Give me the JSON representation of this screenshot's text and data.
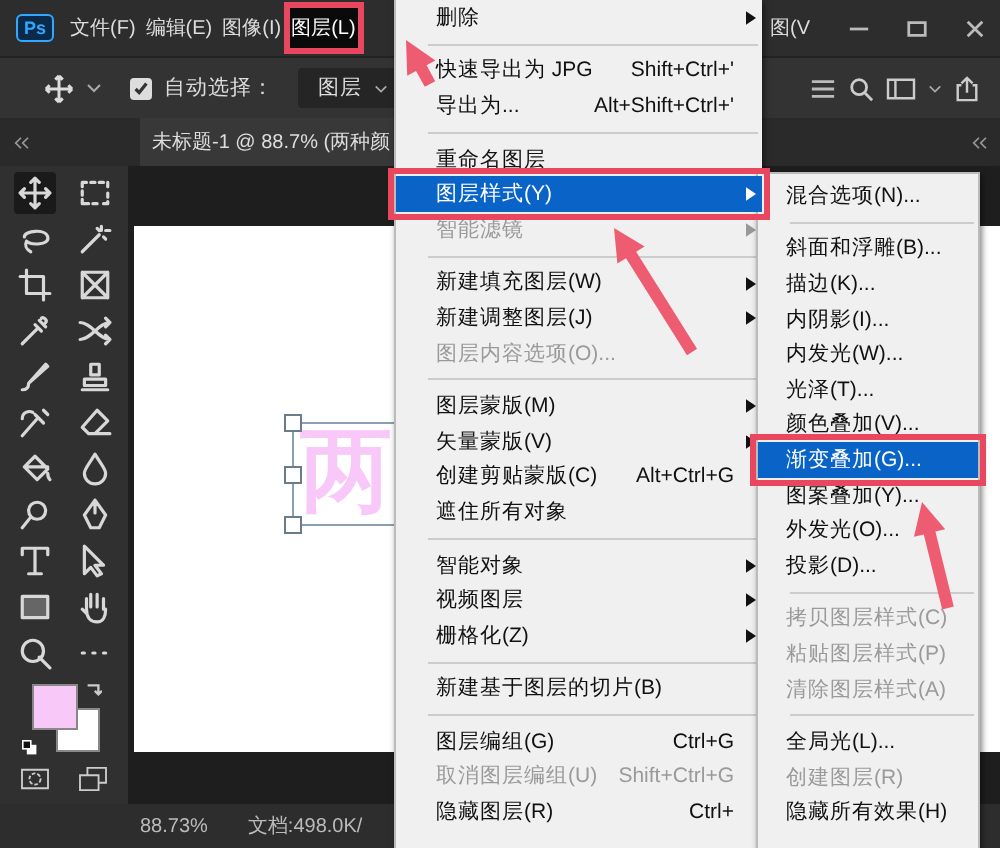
{
  "logo": "Ps",
  "menubar": {
    "items": [
      {
        "label": "文件(F)",
        "selected": false
      },
      {
        "label": "编辑(E)",
        "selected": false
      },
      {
        "label": "图像(I)",
        "selected": false
      },
      {
        "label": "图层(L)",
        "selected": true
      }
    ],
    "partial_label": "图(V"
  },
  "options_bar": {
    "auto_select": {
      "label": "自动选择：",
      "checked": true
    },
    "target_dropdown": "图层"
  },
  "document_tab": "未标题-1 @ 88.7% (两种颜",
  "canvas": {
    "text": "两"
  },
  "status_bar": {
    "zoom": "88.73%",
    "doc_info": "文档:498.0K/"
  },
  "layer_menu": {
    "items": [
      {
        "kind": "item",
        "label": "删除",
        "submenu": true,
        "disabled": false,
        "selected": false
      },
      {
        "kind": "separator"
      },
      {
        "kind": "item",
        "label": "快速导出为 JPG",
        "shortcut": "Shift+Ctrl+'",
        "submenu": false,
        "disabled": false,
        "selected": false
      },
      {
        "kind": "item",
        "label": "导出为...",
        "shortcut": "Alt+Shift+Ctrl+'",
        "submenu": false,
        "disabled": false,
        "selected": false
      },
      {
        "kind": "separator"
      },
      {
        "kind": "item",
        "label": "重命名图层",
        "submenu": false,
        "disabled": false,
        "selected": false
      },
      {
        "kind": "item",
        "label": "图层样式(Y)",
        "submenu": true,
        "disabled": false,
        "selected": true
      },
      {
        "kind": "item",
        "label": "智能滤镜",
        "submenu": true,
        "disabled": true,
        "selected": false
      },
      {
        "kind": "separator"
      },
      {
        "kind": "item",
        "label": "新建填充图层(W)",
        "submenu": true,
        "disabled": false,
        "selected": false
      },
      {
        "kind": "item",
        "label": "新建调整图层(J)",
        "submenu": true,
        "disabled": false,
        "selected": false
      },
      {
        "kind": "item",
        "label": "图层内容选项(O)...",
        "submenu": false,
        "disabled": true,
        "selected": false
      },
      {
        "kind": "separator"
      },
      {
        "kind": "item",
        "label": "图层蒙版(M)",
        "submenu": true,
        "disabled": false,
        "selected": false
      },
      {
        "kind": "item",
        "label": "矢量蒙版(V)",
        "submenu": true,
        "disabled": false,
        "selected": false
      },
      {
        "kind": "item",
        "label": "创建剪贴蒙版(C)",
        "shortcut": "Alt+Ctrl+G",
        "submenu": false,
        "disabled": false,
        "selected": false
      },
      {
        "kind": "item",
        "label": "遮住所有对象",
        "submenu": false,
        "disabled": false,
        "selected": false
      },
      {
        "kind": "separator"
      },
      {
        "kind": "item",
        "label": "智能对象",
        "submenu": true,
        "disabled": false,
        "selected": false
      },
      {
        "kind": "item",
        "label": "视频图层",
        "submenu": true,
        "disabled": false,
        "selected": false
      },
      {
        "kind": "item",
        "label": "栅格化(Z)",
        "submenu": true,
        "disabled": false,
        "selected": false
      },
      {
        "kind": "separator"
      },
      {
        "kind": "item",
        "label": "新建基于图层的切片(B)",
        "submenu": false,
        "disabled": false,
        "selected": false
      },
      {
        "kind": "separator"
      },
      {
        "kind": "item",
        "label": "图层编组(G)",
        "shortcut": "Ctrl+G",
        "submenu": false,
        "disabled": false,
        "selected": false
      },
      {
        "kind": "item",
        "label": "取消图层编组(U)",
        "shortcut": "Shift+Ctrl+G",
        "submenu": false,
        "disabled": true,
        "selected": false
      },
      {
        "kind": "item",
        "label": "隐藏图层(R)",
        "shortcut": "Ctrl+",
        "submenu": false,
        "disabled": false,
        "selected": false
      }
    ]
  },
  "style_submenu": {
    "items": [
      {
        "kind": "item",
        "label": "混合选项(N)...",
        "disabled": false,
        "selected": false
      },
      {
        "kind": "separator"
      },
      {
        "kind": "item",
        "label": "斜面和浮雕(B)...",
        "disabled": false,
        "selected": false
      },
      {
        "kind": "item",
        "label": "描边(K)...",
        "disabled": false,
        "selected": false
      },
      {
        "kind": "item",
        "label": "内阴影(I)...",
        "disabled": false,
        "selected": false
      },
      {
        "kind": "item",
        "label": "内发光(W)...",
        "disabled": false,
        "selected": false
      },
      {
        "kind": "item",
        "label": "光泽(T)...",
        "disabled": false,
        "selected": false
      },
      {
        "kind": "item",
        "label": "颜色叠加(V)...",
        "disabled": false,
        "selected": false
      },
      {
        "kind": "item",
        "label": "渐变叠加(G)...",
        "disabled": false,
        "selected": true
      },
      {
        "kind": "item",
        "label": "图案叠加(Y)...",
        "disabled": false,
        "selected": false
      },
      {
        "kind": "item",
        "label": "外发光(O)...",
        "disabled": false,
        "selected": false
      },
      {
        "kind": "item",
        "label": "投影(D)...",
        "disabled": false,
        "selected": false
      },
      {
        "kind": "separator"
      },
      {
        "kind": "item",
        "label": "拷贝图层样式(C)",
        "disabled": true,
        "selected": false
      },
      {
        "kind": "item",
        "label": "粘贴图层样式(P)",
        "disabled": true,
        "selected": false
      },
      {
        "kind": "item",
        "label": "清除图层样式(A)",
        "disabled": true,
        "selected": false
      },
      {
        "kind": "separator"
      },
      {
        "kind": "item",
        "label": "全局光(L)...",
        "disabled": false,
        "selected": false
      },
      {
        "kind": "item",
        "label": "创建图层(R)",
        "disabled": true,
        "selected": false
      },
      {
        "kind": "item",
        "label": "隐藏所有效果(H)",
        "disabled": false,
        "selected": false
      }
    ]
  }
}
